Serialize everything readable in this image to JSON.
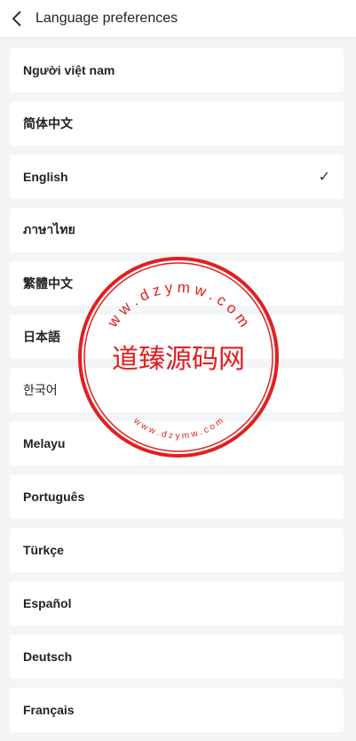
{
  "header": {
    "title": "Language preferences",
    "back_icon": "chevron-left-icon"
  },
  "languages": [
    {
      "label": "Người việt nam",
      "selected": false
    },
    {
      "label": "简体中文",
      "selected": false
    },
    {
      "label": "English",
      "selected": true
    },
    {
      "label": "ภาษาไทย",
      "selected": false
    },
    {
      "label": "繁體中文",
      "selected": false
    },
    {
      "label": "日本語",
      "selected": false
    },
    {
      "label": "한국어",
      "selected": false
    },
    {
      "label": "Melayu",
      "selected": false
    },
    {
      "label": "Português",
      "selected": false
    },
    {
      "label": "Türkçe",
      "selected": false
    },
    {
      "label": "Español",
      "selected": false
    },
    {
      "label": "Deutsch",
      "selected": false
    },
    {
      "label": "Français",
      "selected": false
    }
  ],
  "check_mark": "✓",
  "watermark": {
    "center_text": "道臻源码网",
    "top_text": "w w . d z y m w . c o m",
    "bottom_text": "w w w . d z y m w . c o m",
    "color": "#e02020"
  }
}
